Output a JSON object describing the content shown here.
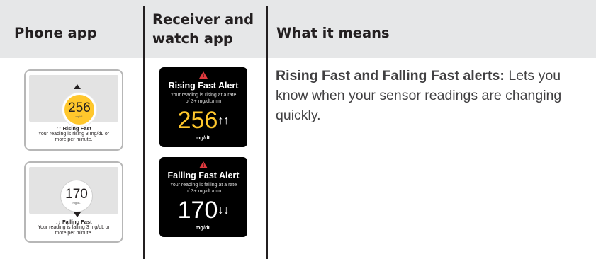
{
  "header": {
    "col_phone": "Phone app",
    "col_receiver": "Receiver and watch app",
    "col_means": "What it means"
  },
  "phone_cards": [
    {
      "value": "256",
      "unit": "mg/dL",
      "title": "↑↑ Rising Fast",
      "body": "Your reading is rising 3 mg/dL or more per minute.",
      "circle_color": "#ffc72c"
    },
    {
      "value": "170",
      "unit": "mg/dL",
      "title": "↓↓ Falling Fast",
      "body": "Your reading is falling 3 mg/dL or more per minute.",
      "circle_color": "#ffffff"
    }
  ],
  "receiver_cards": [
    {
      "title": "Rising Fast Alert",
      "body": "Your reading is rising at a rate of 3+ mg/dL/min",
      "value": "256",
      "arrows": "↑↑",
      "unit": "mg/dL",
      "value_color": "#ffc72c",
      "icon": "warning-icon"
    },
    {
      "title": "Falling Fast Alert",
      "body": "Your reading is falling at a rate of 3+ mg/dL/min",
      "value": "170",
      "arrows": "↓↓",
      "unit": "mg/dL",
      "value_color": "#ffffff",
      "icon": "warning-icon"
    }
  ],
  "description": {
    "bold": "Rising Fast and Falling Fast alerts:",
    "text": " Lets you know when your sensor readings are changing quickly."
  },
  "colors": {
    "header_bg": "#e6e7e8",
    "alert_red": "#e03a3e",
    "high_yellow": "#ffc72c"
  }
}
